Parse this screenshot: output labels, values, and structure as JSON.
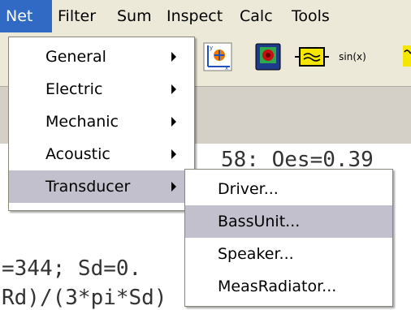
{
  "menubar": {
    "items": [
      "Net",
      "Filter",
      "Sum",
      "Inspect",
      "Calc",
      "Tools"
    ]
  },
  "toolbar": {
    "sin_label": "sin(x)"
  },
  "editor": {
    "line1": "58: Oes=0.39",
    "line2": "=344; Sd=0.",
    "line3": "Rd)/(3*pi*Sd)"
  },
  "net_menu": {
    "items": [
      {
        "label": "General"
      },
      {
        "label": "Electric"
      },
      {
        "label": "Mechanic"
      },
      {
        "label": "Acoustic"
      },
      {
        "label": "Transducer"
      }
    ]
  },
  "transducer_menu": {
    "items": [
      {
        "label": "Driver..."
      },
      {
        "label": "BassUnit..."
      },
      {
        "label": "Speaker..."
      },
      {
        "label": "MeasRadiator..."
      }
    ]
  }
}
